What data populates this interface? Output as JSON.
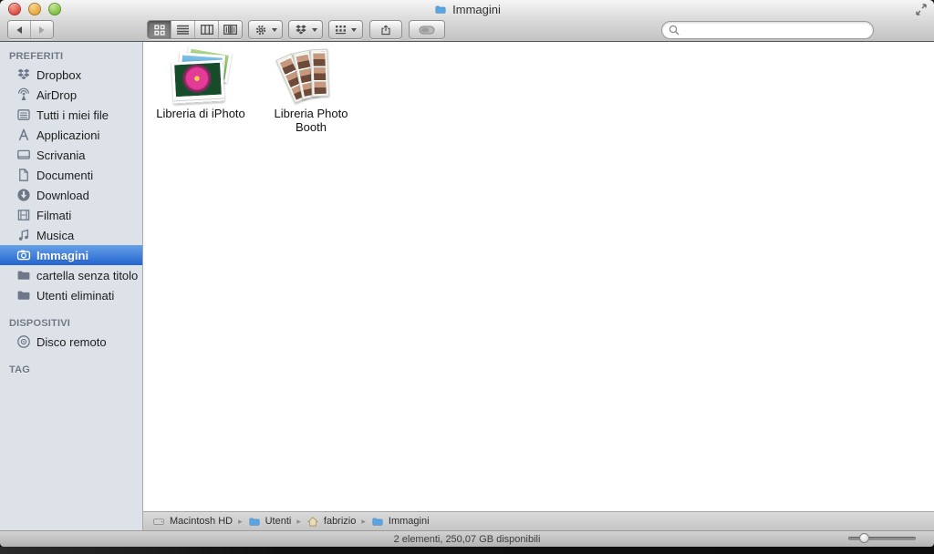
{
  "titlebar": {
    "title": "Immagini"
  },
  "toolbar": {
    "icons": {
      "back": "left-triangle",
      "forward": "right-triangle",
      "view_grid": "icon-view-grid",
      "view_list": "list-lines",
      "view_columns": "columns",
      "view_coverflow": "coverflow",
      "action": "gear",
      "dropbox_menu": "dropbox-logo",
      "arrange": "item-grid",
      "share": "arrow-out-of-box",
      "tags": "pill"
    }
  },
  "search": {
    "placeholder": "",
    "value": "",
    "icon": "magnifier"
  },
  "sidebar": {
    "sections": [
      {
        "label": "PREFERITI",
        "items": [
          {
            "label": "Dropbox",
            "icon": "dropbox-icon"
          },
          {
            "label": "AirDrop",
            "icon": "airdrop-icon"
          },
          {
            "label": "Tutti i miei file",
            "icon": "all-files-icon"
          },
          {
            "label": "Applicazioni",
            "icon": "applications-icon"
          },
          {
            "label": "Scrivania",
            "icon": "desktop-icon"
          },
          {
            "label": "Documenti",
            "icon": "documents-icon"
          },
          {
            "label": "Download",
            "icon": "download-icon"
          },
          {
            "label": "Filmati",
            "icon": "movies-icon"
          },
          {
            "label": "Musica",
            "icon": "music-icon"
          },
          {
            "label": "Immagini",
            "icon": "camera-icon",
            "selected": true
          },
          {
            "label": "cartella senza titolo",
            "icon": "folder-icon"
          },
          {
            "label": "Utenti eliminati",
            "icon": "folder-icon"
          }
        ]
      },
      {
        "label": "DISPOSITIVI",
        "items": [
          {
            "label": "Disco remoto",
            "icon": "disc-icon"
          }
        ]
      },
      {
        "label": "TAG",
        "items": []
      }
    ]
  },
  "content": {
    "items": [
      {
        "label": "Libreria di iPhoto",
        "icon": "iphoto-library-icon"
      },
      {
        "label": "Libreria Photo Booth",
        "icon": "photobooth-library-icon"
      }
    ]
  },
  "pathbar": {
    "segments": [
      {
        "label": "Macintosh HD",
        "icon": "hard-disk-icon"
      },
      {
        "label": "Utenti",
        "icon": "folder-icon"
      },
      {
        "label": "fabrizio",
        "icon": "home-icon"
      },
      {
        "label": "Immagini",
        "icon": "folder-icon"
      }
    ]
  },
  "statusbar": {
    "text": "2 elementi, 250,07 GB disponibili"
  },
  "colors": {
    "selection_top": "#66a0e6",
    "selection_bottom": "#2365d0",
    "sidebar_bg": "#dce2e8",
    "folder_blue": "#5aa4e2",
    "traffic_red": "#dd4a3e",
    "traffic_yellow": "#e7a63b",
    "traffic_green": "#7cc043"
  }
}
